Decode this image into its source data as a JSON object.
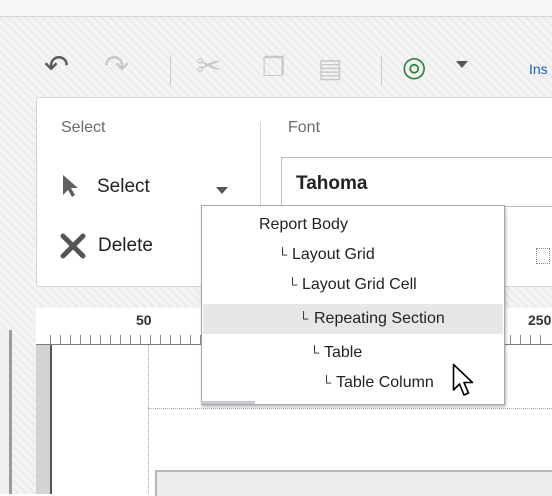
{
  "quick_access": {
    "tab_partial_label": "Ins"
  },
  "ribbon": {
    "select_group": {
      "label": "Select",
      "select_button": "Select",
      "delete_button": "Delete"
    },
    "font_group": {
      "label": "Font",
      "font_name": "Tahoma"
    }
  },
  "ruler": {
    "labels": [
      "50",
      "250"
    ]
  },
  "select_menu": {
    "items": [
      {
        "label": "Report Body",
        "prefix": ""
      },
      {
        "label": "Layout Grid",
        "prefix": "└"
      },
      {
        "label": "Layout Grid Cell",
        "prefix": "└"
      },
      {
        "label": "Repeating Section",
        "prefix": "└"
      },
      {
        "label": "Table",
        "prefix": "└"
      },
      {
        "label": "Table Column",
        "prefix": "└"
      }
    ],
    "highlighted_index": 3
  },
  "colors": {
    "accent_blue": "#1a5fb0",
    "delete_x": "#555555",
    "highlight": "#e7e7e7"
  }
}
